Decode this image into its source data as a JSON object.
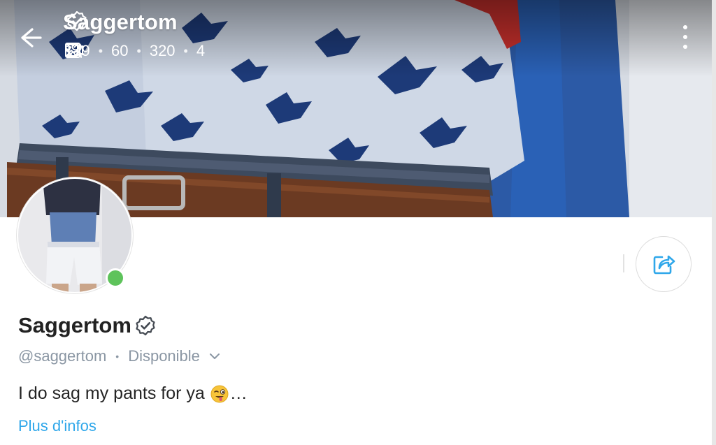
{
  "header": {
    "title": "Saggertom",
    "stats": {
      "photos": "139",
      "videos": "60",
      "likes": "320",
      "fans": "4"
    }
  },
  "profile": {
    "display_name": "Saggertom",
    "handle": "@saggertom",
    "separator": "•",
    "status": "Disponible",
    "bio": "I do sag my pants for ya",
    "bio_ellipsis": "…",
    "more_info": "Plus d'infos"
  },
  "colors": {
    "accent": "#2fa7ea",
    "online": "#5ec35b",
    "muted_text": "#8a96a3",
    "text": "#222222"
  },
  "icons": {
    "back": "arrow-left-icon",
    "verified": "verified-badge-icon",
    "photos": "image-icon",
    "videos": "video-icon",
    "likes": "heart-icon",
    "fans": "user-heart-icon",
    "more": "more-vertical-icon",
    "share": "share-icon",
    "status_dropdown": "chevron-down-icon",
    "emoji": "winking-tongue-emoji"
  }
}
